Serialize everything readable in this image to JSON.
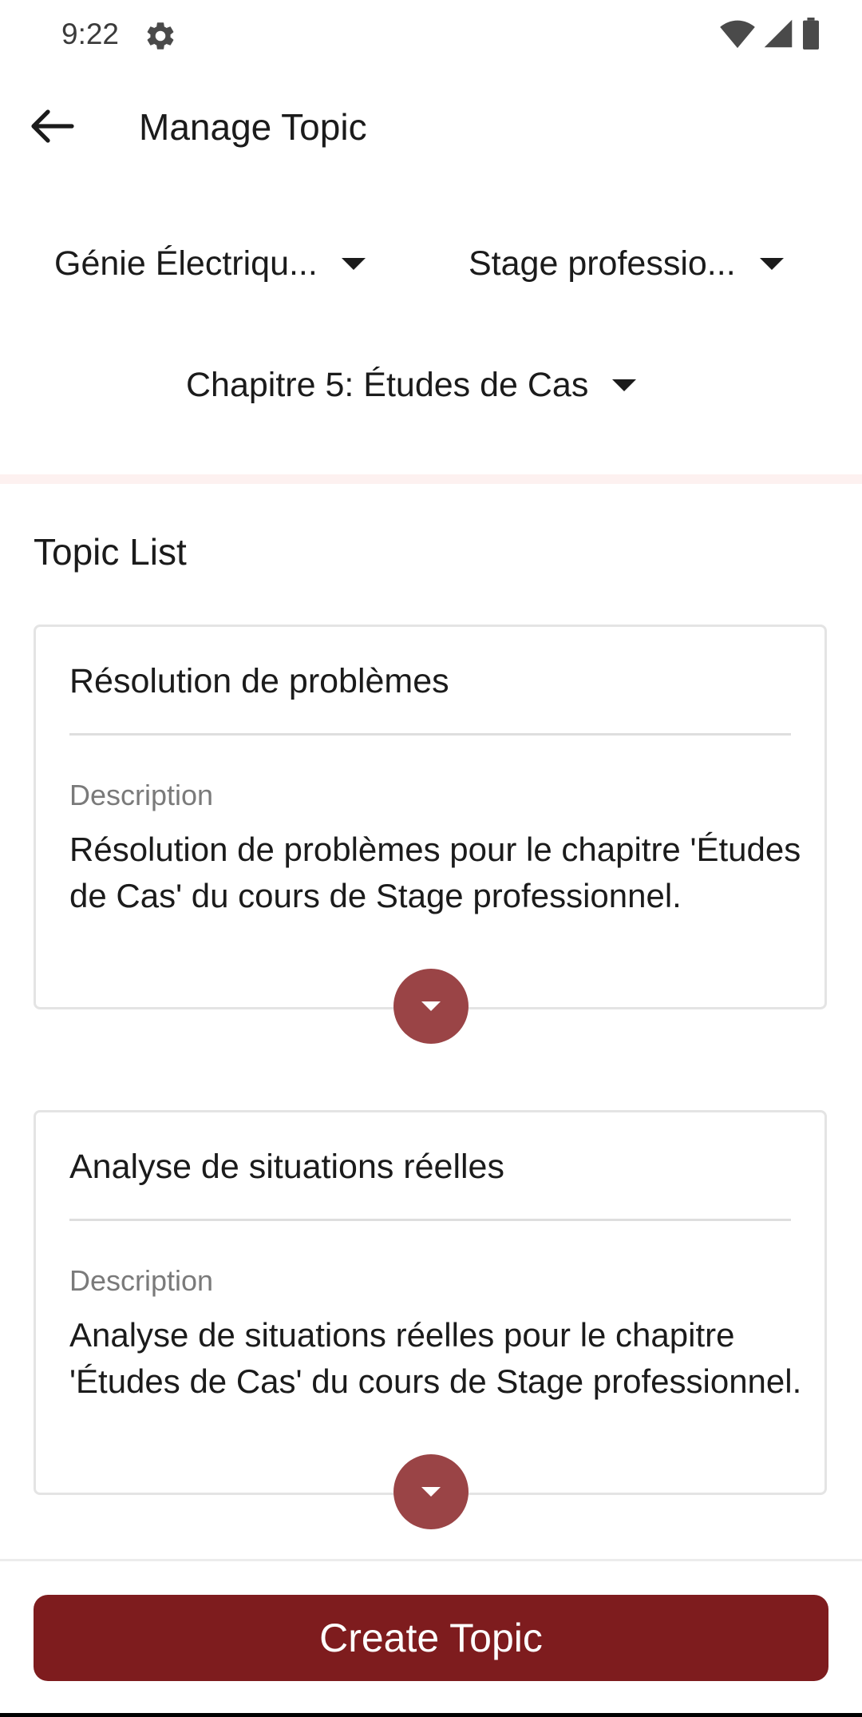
{
  "status_bar": {
    "time": "9:22",
    "icons": [
      "gear-icon",
      "wifi-icon",
      "signal-icon",
      "battery-icon"
    ]
  },
  "app_bar": {
    "title": "Manage Topic",
    "back_icon": "arrow-left-icon"
  },
  "filters": {
    "department": "Génie Électriqu...",
    "course": "Stage professio...",
    "chapter": "Chapitre 5: Études de Cas"
  },
  "section": {
    "title": "Topic List"
  },
  "topics": [
    {
      "title": "Résolution de problèmes",
      "description_label": "Description",
      "description": "Résolution de problèmes pour le chapitre 'Études de Cas' du cours de Stage professionnel."
    },
    {
      "title": "Analyse de situations réelles",
      "description_label": "Description",
      "description": "Analyse de situations réelles pour le chapitre 'Études de Cas' du cours de Stage professionnel."
    }
  ],
  "actions": {
    "create_label": "Create Topic"
  },
  "colors": {
    "primary": "#7e1c1e",
    "expand_button": "#9a4446",
    "band": "#fdf1f0"
  }
}
